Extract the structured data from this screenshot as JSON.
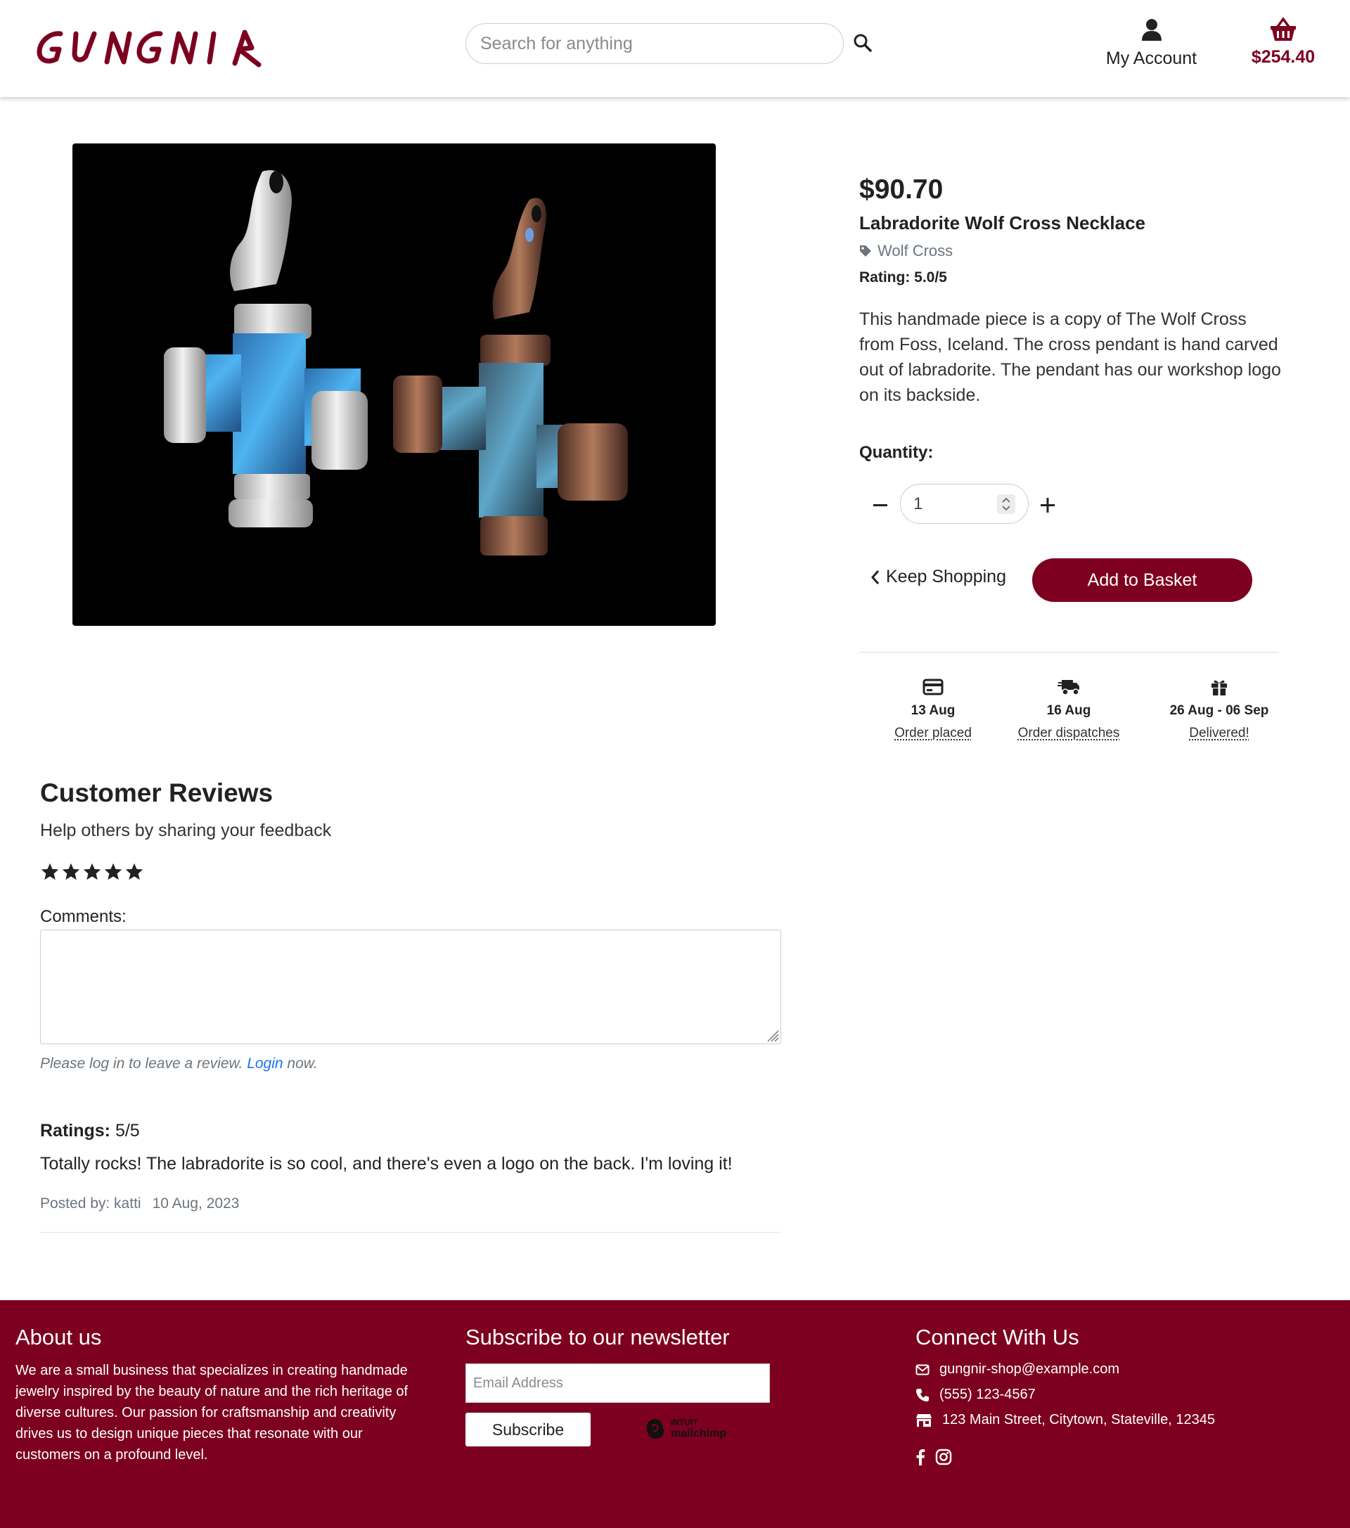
{
  "header": {
    "logo_text": "GUNGNIR",
    "search_placeholder": "Search for anything",
    "account_label": "My Account",
    "cart_total": "$254.40"
  },
  "product": {
    "price": "$90.70",
    "name": "Labradorite Wolf Cross Necklace",
    "tag": "Wolf Cross",
    "rating": "Rating: 5.0/5",
    "description": "This handmade piece is a copy of The Wolf Cross from Foss, Iceland. The cross pendant is hand carved out of labradorite. The pendant has our workshop logo on its backside.",
    "quantity_label": "Quantity:",
    "quantity_value": "1",
    "keep_shopping_label": "Keep Shopping",
    "add_to_basket_label": "Add to Basket"
  },
  "delivery_steps": [
    {
      "icon": "credit-card-icon",
      "date": "13 Aug",
      "label": "Order placed"
    },
    {
      "icon": "shipping-truck-icon",
      "date": "16 Aug",
      "label": "Order dispatches"
    },
    {
      "icon": "gift-icon",
      "date": "26 Aug - 06 Sep",
      "label": "Delivered!"
    }
  ],
  "reviews": {
    "title": "Customer Reviews",
    "subtitle": "Help others by sharing your feedback",
    "stars_selected": 5,
    "comments_label": "Comments:",
    "login_note_prefix": "Please log in to leave a review.",
    "login_link": "Login",
    "login_note_suffix": "now.",
    "items": [
      {
        "ratings_label": "Ratings:",
        "ratings_value": "5/5",
        "text": "Totally rocks! The labradorite is so cool, and there's even a logo on the back. I'm loving it!",
        "posted_by": "Posted by: katti",
        "date": "10 Aug, 2023"
      }
    ]
  },
  "footer": {
    "about_title": "About us",
    "about_text": "We are a small business that specializes in creating handmade jewelry inspired by the beauty of nature and the rich heritage of diverse cultures. Our passion for craftsmanship and creativity drives us to design unique pieces that resonate with our customers on a profound level.",
    "newsletter_title": "Subscribe to our newsletter",
    "email_placeholder": "Email Address",
    "subscribe_label": "Subscribe",
    "mailchimp_line1": "INTUIT",
    "mailchimp_line2": "mailchimp",
    "connect_title": "Connect With Us",
    "email": "gungnir-shop@example.com",
    "phone": "(555) 123-4567",
    "address": "123 Main Street, Citytown, Stateville, 12345"
  },
  "colors": {
    "brand": "#7d0020",
    "text": "#222222",
    "muted": "#6c757d",
    "link": "#1a73e8"
  }
}
